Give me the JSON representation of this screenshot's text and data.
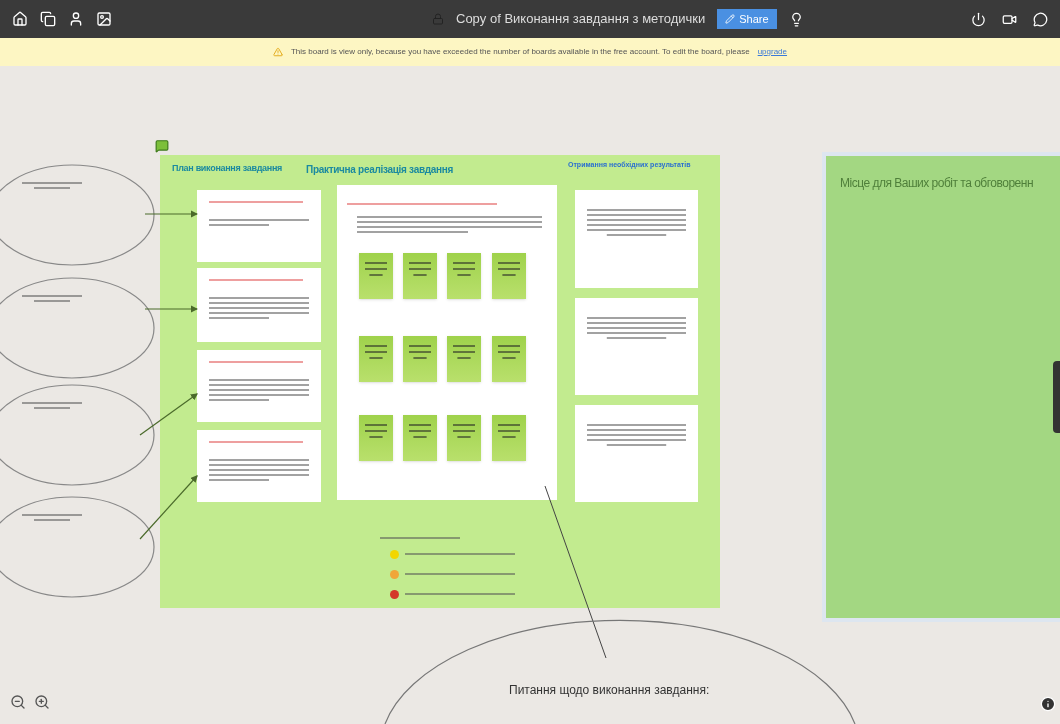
{
  "toolbar": {
    "title": "Copy of Виконання завдання з методички",
    "share_button": "Share"
  },
  "banner": {
    "message": "This board is view only, because you have exceeded the number of boards available in the free account. To edit the board, please",
    "link": "upgrade"
  },
  "main_frame": {
    "headings": [
      "План виконання завдання",
      "Практична реалізація завдання",
      "Отримання необхідних результатів"
    ]
  },
  "legend": {
    "items": [
      {
        "color": "#f2d600"
      },
      {
        "color": "#f0a63a"
      },
      {
        "color": "#d4382a"
      }
    ]
  },
  "work_frame": {
    "title": "Місце для Ваших робіт та обговоренн"
  },
  "question_ellipse": {
    "text": "Питання щодо виконання завдання:"
  }
}
